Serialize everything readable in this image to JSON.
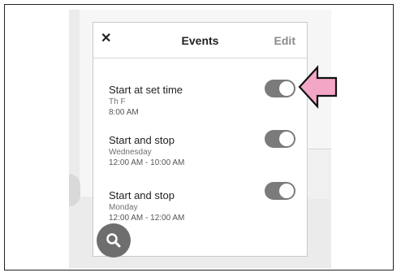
{
  "header": {
    "title": "Events",
    "edit_label": "Edit",
    "close_glyph": "✕"
  },
  "events": [
    {
      "name": "Start at set time",
      "days": "Th F",
      "time": "8:00 AM",
      "enabled": true
    },
    {
      "name": "Start and stop",
      "days": "Wednesday",
      "time": "12:00 AM - 10:00 AM",
      "enabled": true
    },
    {
      "name": "Start and stop",
      "days": "Monday",
      "time": "12:00 AM - 12:00 AM",
      "enabled": true
    }
  ],
  "icons": {
    "close": "close-icon",
    "search": "search-icon",
    "pointer": "pointer-arrow-icon"
  },
  "colors": {
    "toggle": "#7b7b7b",
    "fab": "#6e6e6e",
    "arrow": "#f4a6c6",
    "edit_text": "#8a8a8a"
  }
}
